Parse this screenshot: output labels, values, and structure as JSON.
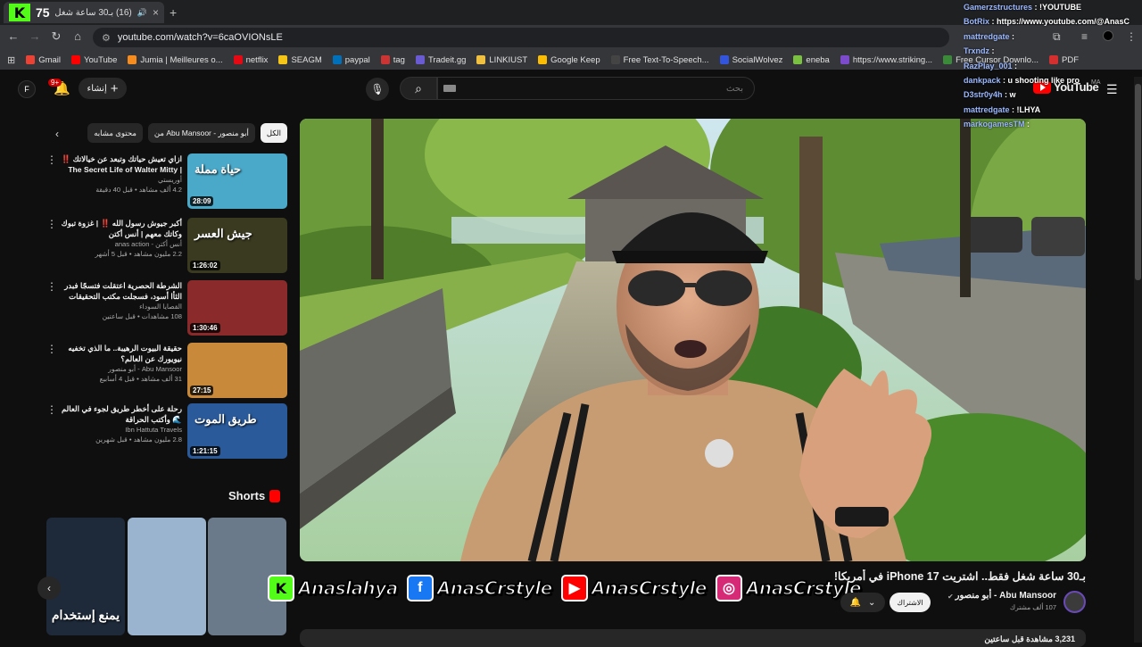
{
  "browser": {
    "tab_count": "75",
    "tab_title": "(16) بـ30 ساعة شغل فقط...",
    "tab_close": "×",
    "new_tab": "+",
    "url": "youtube.com/watch?v=6caOVIONsLE",
    "bookmarks": [
      {
        "label": "Gmail",
        "color": "#ea4335"
      },
      {
        "label": "YouTube",
        "color": "#ff0000"
      },
      {
        "label": "Jumia | Meilleures o...",
        "color": "#f68b1e"
      },
      {
        "label": "netflix",
        "color": "#e50914"
      },
      {
        "label": "SEAGM",
        "color": "#f5c518"
      },
      {
        "label": "paypal",
        "color": "#0070ba"
      },
      {
        "label": "tag",
        "color": "#cc3333"
      },
      {
        "label": "Tradeit.gg",
        "color": "#6b5bd2"
      },
      {
        "label": "LINKIUST",
        "color": "#f0c040"
      },
      {
        "label": "Google Keep",
        "color": "#fbbc04"
      },
      {
        "label": "Free Text-To-Speech...",
        "color": "#444444"
      },
      {
        "label": "SocialWolvez",
        "color": "#3355dd"
      },
      {
        "label": "eneba",
        "color": "#7ac142"
      },
      {
        "label": "https://www.striking...",
        "color": "#7b4bcc"
      },
      {
        "label": "Free Cursor Downlo...",
        "color": "#3a8a3a"
      },
      {
        "label": "PDF",
        "color": "#d32f2f"
      }
    ]
  },
  "chat": [
    {
      "name": "Gamerzstructures",
      "msg": " : !YOUTUBE"
    },
    {
      "name": "BotRix",
      "msg": " : https://www.youtube.com/@AnasC"
    },
    {
      "name": "mattredgate",
      "msg": " : "
    },
    {
      "name": "Trxndz",
      "msg": " : "
    },
    {
      "name": "RazPlay_001",
      "msg": " : "
    },
    {
      "name": "dankpack",
      "msg": " : u shooting like pro"
    },
    {
      "name": "D3str0y4h",
      "msg": " : w"
    },
    {
      "name": "mattredgate",
      "msg": " : !LHYA"
    },
    {
      "name": "markogamesTM",
      "msg": " : "
    }
  ],
  "youtube": {
    "avatar_letter": "F",
    "notif_count": "9+",
    "create_label": "إنشاء",
    "search_placeholder": "بحث",
    "logo_text": "YouTube",
    "region": "MA"
  },
  "chips": [
    {
      "label": "الكل",
      "active": true
    },
    {
      "label": "من Abu Mansoor - أبو منصور",
      "active": false
    },
    {
      "label": "محتوى مشابه",
      "active": false
    }
  ],
  "recommendations": [
    {
      "title": "ازاي تعيش حياتك وتبعد عن خيالاتك ‼️ | The Secret Life of Walter Mitty",
      "channel": "أوريستي",
      "meta": "4.2 ألف مشاهد • قبل 40 دقيقة",
      "duration": "28:09",
      "thumb_bg": "#4aa8c8",
      "thumb_text": "حياة مملة"
    },
    {
      "title": "أكبر جيوش رسول الله ‼️ | غزوة تبوك وكاتك معهم | أنس أكتن",
      "channel": "أنس أكتن - anas action",
      "meta": "2.2 مليون مشاهد • قبل 5 أشهر",
      "duration": "1:26:02",
      "thumb_bg": "#3a3a20",
      "thumb_text": "جيش العسر"
    },
    {
      "title": "الشرطة الحصرية اعتقلت فتسجًا فبدر الثأا أسود، فسجلت مكتب التحقيقات الفيدرالي ...",
      "channel": "القصايا السوداء",
      "meta": "108 مشاهدات • قبل ساعتين",
      "duration": "1:30:46",
      "thumb_bg": "#8a2a2a",
      "thumb_text": ""
    },
    {
      "title": "حقيقة البيوت الرهيبة.. ما الذي تخفيه نيويورك عن العالم؟",
      "channel": "Abu Mansoor - أبو منصور",
      "meta": "31 ألف مشاهد • قبل 4 أسابيع",
      "duration": "27:15",
      "thumb_bg": "#c88a3a",
      "thumb_text": ""
    },
    {
      "title": "رحلة على أخطر طريق لجوء في العالم 🌊 وأكتب الحراقة",
      "channel": "Ibn Hattuta Travels",
      "meta": "2.8 مليون مشاهد • قبل شهرين",
      "duration": "1:21:15",
      "thumb_bg": "#2a5a9a",
      "thumb_text": "طريق الموت"
    }
  ],
  "shorts": {
    "heading": "Shorts",
    "items": [
      {
        "caption": "يمنع إستخدام",
        "bg": "#1e2a3a"
      },
      {
        "caption": "",
        "bg": "#9ab4d0"
      },
      {
        "caption": "",
        "bg": "#6a7a8a"
      }
    ]
  },
  "video": {
    "title": "بـ30 ساعة شغل فقط.. اشتريت iPhone 17 في أمريكا!",
    "channel": "Abu Mansoor - أبو منصور",
    "subscribers": "107 ألف مشترك",
    "subscribe_label": "الاشتراك",
    "views": "3,231 مشاهدة قبل ساعتين"
  },
  "overlay": {
    "handles": [
      {
        "platform": "kick-icon",
        "glyph": "K",
        "color": "#53fc18",
        "handle": "Anaslahya"
      },
      {
        "platform": "facebook-icon",
        "glyph": "f",
        "color": "#1877f2",
        "handle": "AnasCrstyle"
      },
      {
        "platform": "youtube-icon",
        "glyph": "▶",
        "color": "#ff0000",
        "handle": "AnasCrstyle"
      },
      {
        "platform": "instagram-icon",
        "glyph": "◎",
        "color": "#d62976",
        "handle": "AnasCrstyle"
      }
    ]
  }
}
